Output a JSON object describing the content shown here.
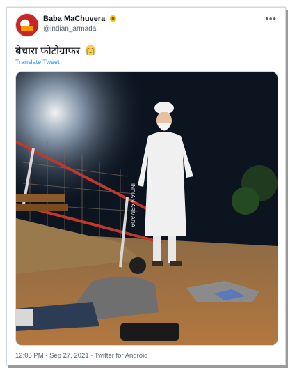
{
  "user": {
    "display_name": "Baba MaChuvera",
    "handle": "@indian_armada",
    "badge_icon": "sunflower-badge-icon"
  },
  "tweet": {
    "text": "बेचारा फोटोग्राफर",
    "emoji_icon": "loudly-crying-face-icon",
    "translate_label": "Translate Tweet",
    "photo_watermark": "INDIAN ARMADA",
    "footer": "12:05 PM · Sep 27, 2021 · Twitter for Android"
  },
  "menu_icon": "more-options-icon",
  "colors": {
    "link": "#1d9bf0",
    "muted": "#536471",
    "border": "#cfd9de"
  }
}
